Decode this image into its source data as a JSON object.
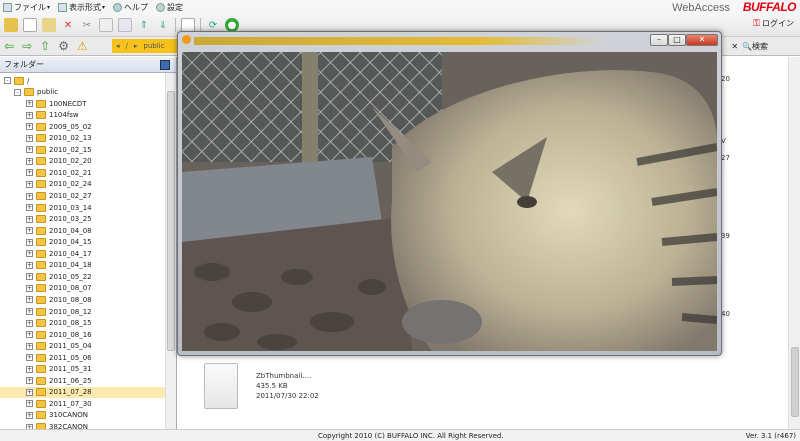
{
  "menubar": {
    "file_label": "ファイル",
    "view_label": "表示形式",
    "help_label": "ヘルプ",
    "settings_label": "設定"
  },
  "brand": {
    "name": "WebAccess",
    "logo": "BUFFALO"
  },
  "login_label": "ログイン",
  "addressbar": {
    "root": "/",
    "folder": "public"
  },
  "search_label": "検索",
  "folder_panel": {
    "title": "フォルダー"
  },
  "tree": {
    "root": "/",
    "public": "public",
    "folders": [
      "100NECDT",
      "1104fsw",
      "2009_05_02",
      "2010_02_13",
      "2010_02_15",
      "2010_02_20",
      "2010_02_21",
      "2010_02_24",
      "2010_02_27",
      "2010_03_14",
      "2010_03_25",
      "2010_04_08",
      "2010_04_15",
      "2010_04_17",
      "2010_04_18",
      "2010_05_22",
      "2010_08_07",
      "2010_08_08",
      "2010_08_12",
      "2010_08_15",
      "2010_08_16",
      "2011_05_04",
      "2011_05_06",
      "2011_05_31",
      "2011_06_25",
      "2011_07_28",
      "2011_07_30",
      "310CANON",
      "382CANON"
    ],
    "selected": "2011_07_28"
  },
  "filelist": {
    "side_times": [
      "20",
      "V",
      "27",
      "39",
      "40"
    ],
    "file": {
      "name": "ZbThumbnail....",
      "size": "435.5 KB",
      "date": "2011/07/30 22:02"
    }
  },
  "footer": {
    "copyright": "Copyright 2010 (C) BUFFALO INC. All Right Reserved.",
    "version": "Ver. 3.1 (r467)"
  },
  "colors": {
    "accent_yellow": "#f5c21b",
    "brand_red": "#e00012",
    "nav_green": "#3a9a2a"
  },
  "icons": {
    "toolbar": [
      "folder-icon",
      "new-file-icon",
      "copy-icon",
      "delete-icon",
      "cut-icon",
      "paste-icon",
      "rename-icon",
      "upload-icon",
      "download-icon",
      "select-all-icon",
      "refresh-icon",
      "go-icon"
    ],
    "addressbar": [
      "back-icon",
      "forward-icon",
      "up-icon",
      "settings-icon",
      "warning-icon"
    ]
  }
}
